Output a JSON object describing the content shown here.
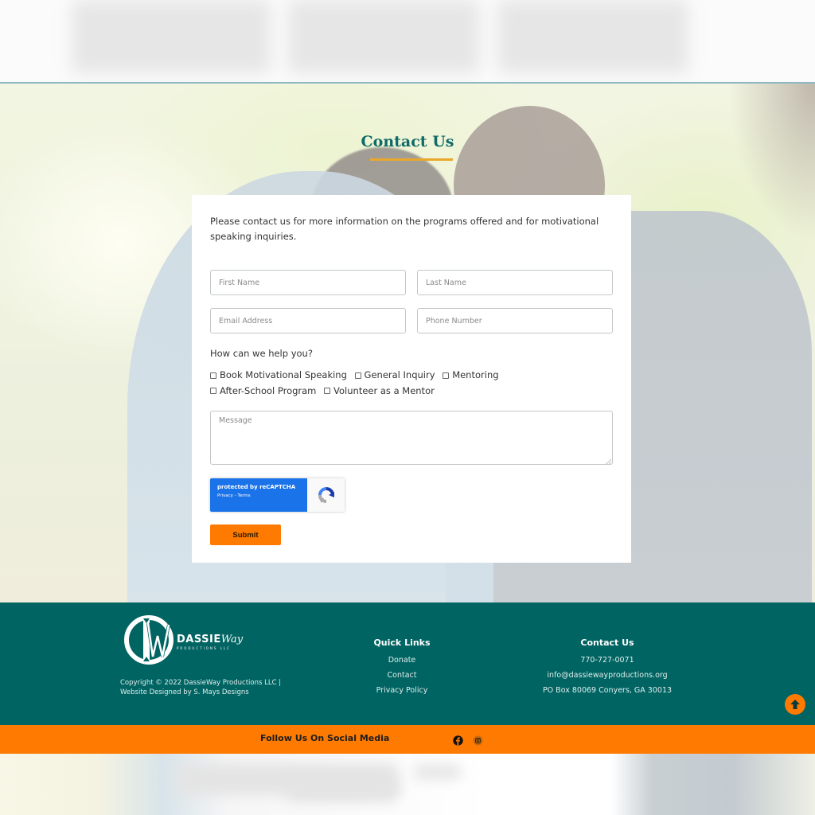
{
  "contact_section": {
    "title": "Contact Us",
    "intro": "Please contact us for more information on the programs offered and for motivational speaking inquiries.",
    "fields": {
      "first_name": {
        "placeholder": "First Name",
        "value": ""
      },
      "last_name": {
        "placeholder": "Last Name",
        "value": ""
      },
      "email": {
        "placeholder": "Email Address",
        "value": ""
      },
      "phone": {
        "placeholder": "Phone Number",
        "value": ""
      },
      "message": {
        "placeholder": "Message",
        "value": ""
      }
    },
    "help_question": "How can we help you?",
    "options": [
      {
        "label": "Book Motivational Speaking",
        "checked": false
      },
      {
        "label": "General Inquiry",
        "checked": false
      },
      {
        "label": "Mentoring",
        "checked": false
      },
      {
        "label": "After-School Program",
        "checked": false
      },
      {
        "label": "Volunteer as a Mentor",
        "checked": false
      }
    ],
    "recaptcha": {
      "line1": "protected by reCAPTCHA",
      "line2": "Privacy - Terms",
      "icon": "recaptcha-logo-icon"
    },
    "submit_label": "Submit"
  },
  "footer": {
    "brand": {
      "monogram": "DW",
      "name": "DASSIE",
      "script": "Way",
      "sub": "PRODUCTIONS LLC"
    },
    "copyright_line1": "Copyright © 2022 DassieWay Productions LLC |",
    "copyright_line2": "Website Designed by S. Mays Designs",
    "quick_links": {
      "heading": "Quick Links",
      "items": [
        "Donate",
        "Contact",
        "Privacy Policy"
      ]
    },
    "contact": {
      "heading": "Contact Us",
      "phone": "770-727-0071",
      "email": "info@dassiewayproductions.org",
      "address": "PO Box 80069 Conyers, GA 30013"
    },
    "scroll_top_icon": "arrow-up-icon"
  },
  "social_bar": {
    "label": "Follow Us On Social Media",
    "icons": [
      "facebook-icon",
      "instagram-icon"
    ]
  },
  "colors": {
    "teal": "#006462",
    "title_teal": "#0f6b68",
    "orange": "#ff7a00",
    "underline_gold": "#e9a82b",
    "recaptcha_blue": "#1a73e8"
  }
}
